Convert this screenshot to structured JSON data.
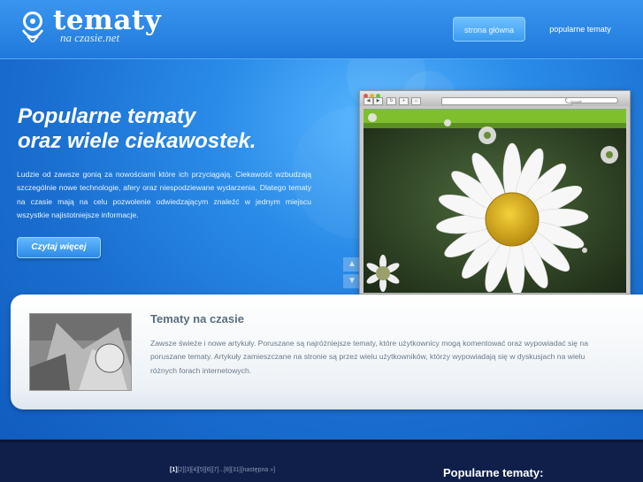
{
  "header": {
    "logo_title": "tematy",
    "logo_sub": "na czasie.net",
    "nav": {
      "home_label": "strona główna",
      "popular_label": "popularne tematy"
    }
  },
  "hero": {
    "headline_line1": "Popularne tematy",
    "headline_line2": "oraz wiele ciekawostek.",
    "intro": "Ludzie od zawsze gonią za nowościami które ich przyciągają. Ciekawość wzbudzają szczególnie nowe technologie, afery oraz niespodziewane wydarzenia. Dlatego tematy na czasie mają na celu pozwolenie odwiedzającym znaleźć w jednym miejscu wszystkie najistotniejsze informacje.",
    "read_more": "Czytaj więcej",
    "browser_search": "Google"
  },
  "feature": {
    "title": "Tematy na czasie",
    "text": "Zawsze świeże i nowe artykuły. Poruszane są najróżniejsze tematy, które użytkownicy mogą komentować oraz wypowiadać się na poruszane tematy. Artykuły zamieszczane na stronie są przez wielu użytkowników, którzy wypowiadają się w dyskusjach na wielu różnych forach internetowych."
  },
  "footer": {
    "pagination": {
      "current": "[1]",
      "pages": "[2][3][4][5][6][7]...[8][31]",
      "next": "[następna »]"
    },
    "heading": "Popularne tematy:"
  },
  "colors": {
    "hero_blue": "#1a6fd0",
    "footer_navy": "#0f1f4a",
    "card_title": "#5a6e80"
  }
}
